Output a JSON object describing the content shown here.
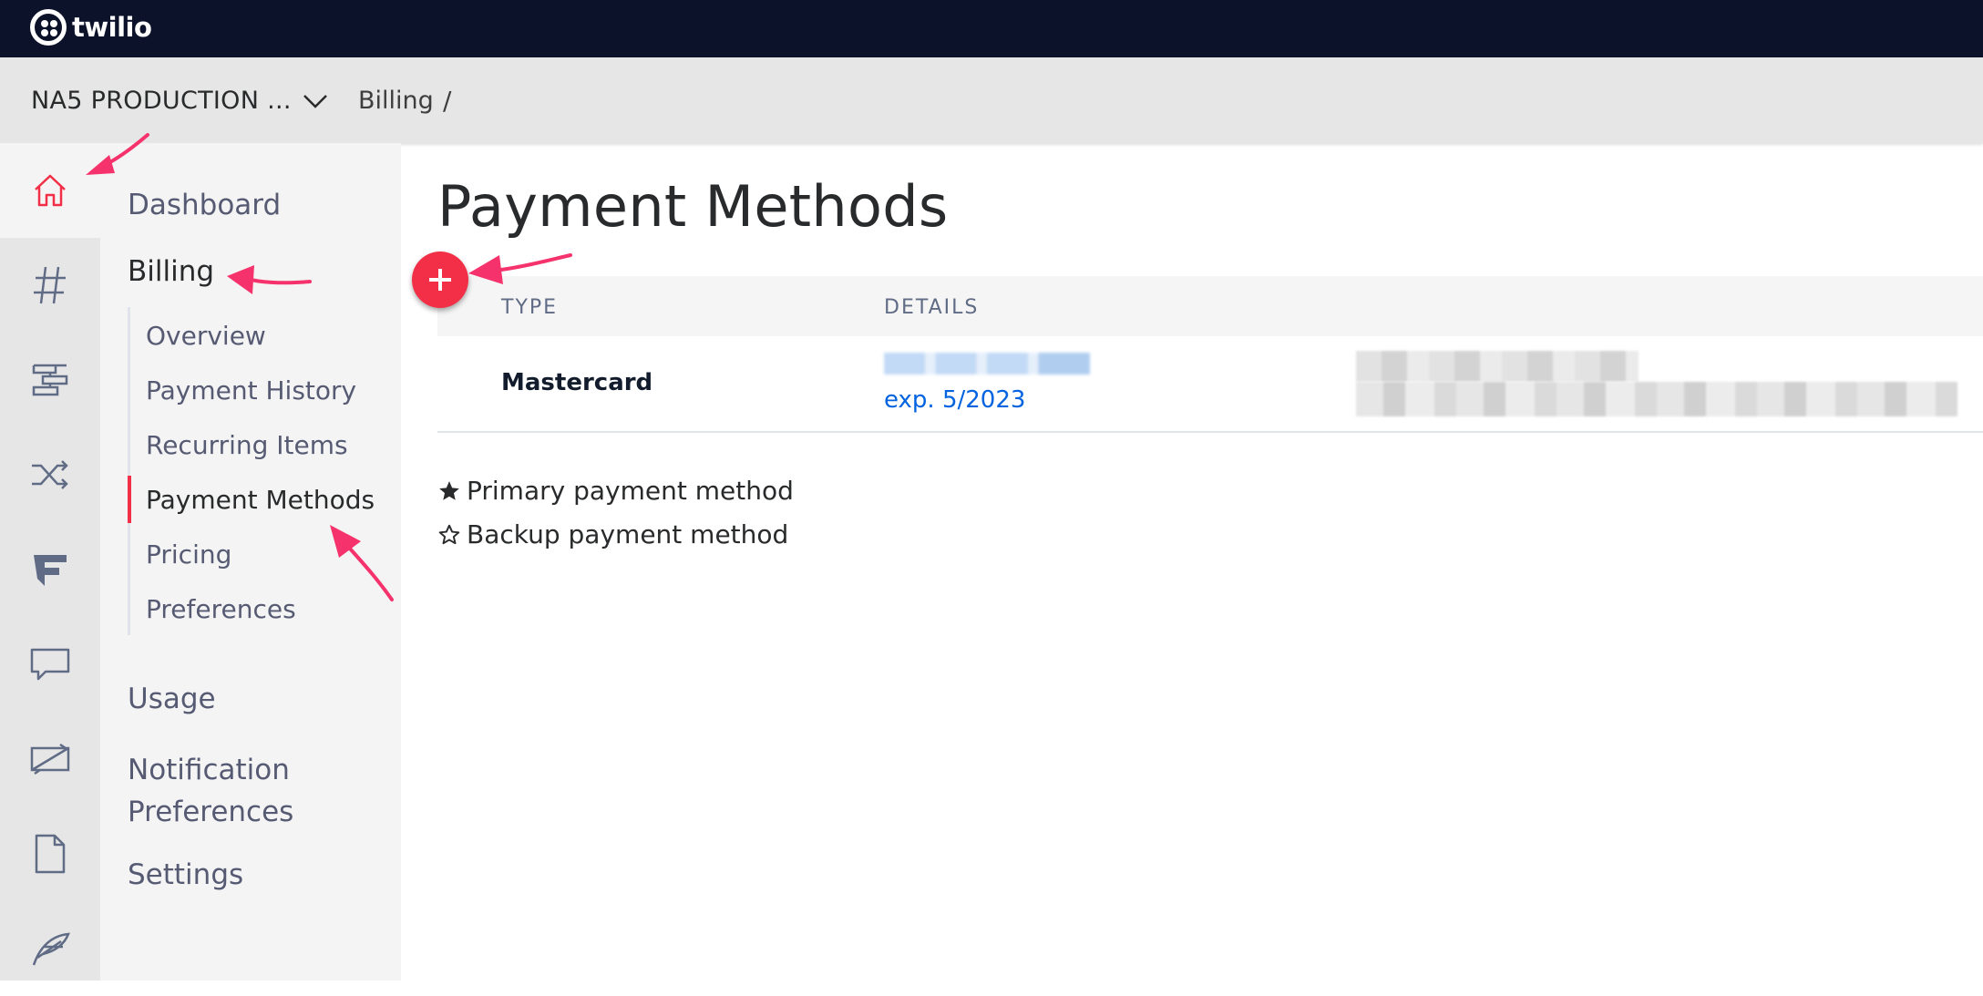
{
  "brand": {
    "name": "twilio"
  },
  "account": {
    "label": "NA5 PRODUCTION ..."
  },
  "breadcrumb": {
    "section": "Billing",
    "separator": "/"
  },
  "rail": {
    "icons": [
      "home-icon",
      "hash-icon",
      "studio-icon",
      "shuffle-icon",
      "flex-icon",
      "chat-icon",
      "video-icon",
      "document-icon",
      "feather-icon"
    ]
  },
  "sidebar": {
    "dashboard": "Dashboard",
    "billing": "Billing",
    "billing_items": [
      "Overview",
      "Payment History",
      "Recurring Items",
      "Payment Methods",
      "Pricing",
      "Preferences"
    ],
    "usage": "Usage",
    "notification_1": "Notification",
    "notification_2": "Preferences",
    "settings": "Settings"
  },
  "page": {
    "title": "Payment Methods"
  },
  "table": {
    "headers": [
      "TYPE",
      "DETAILS"
    ],
    "rows": [
      {
        "type": "Mastercard",
        "expiry": "exp. 5/2023"
      }
    ]
  },
  "legend": {
    "primary": "Primary payment method",
    "backup": "Backup payment method"
  },
  "colors": {
    "accent": "#f22f46",
    "topbar": "#0d122b",
    "link": "#0263e0",
    "annotation": "#f5326b"
  }
}
